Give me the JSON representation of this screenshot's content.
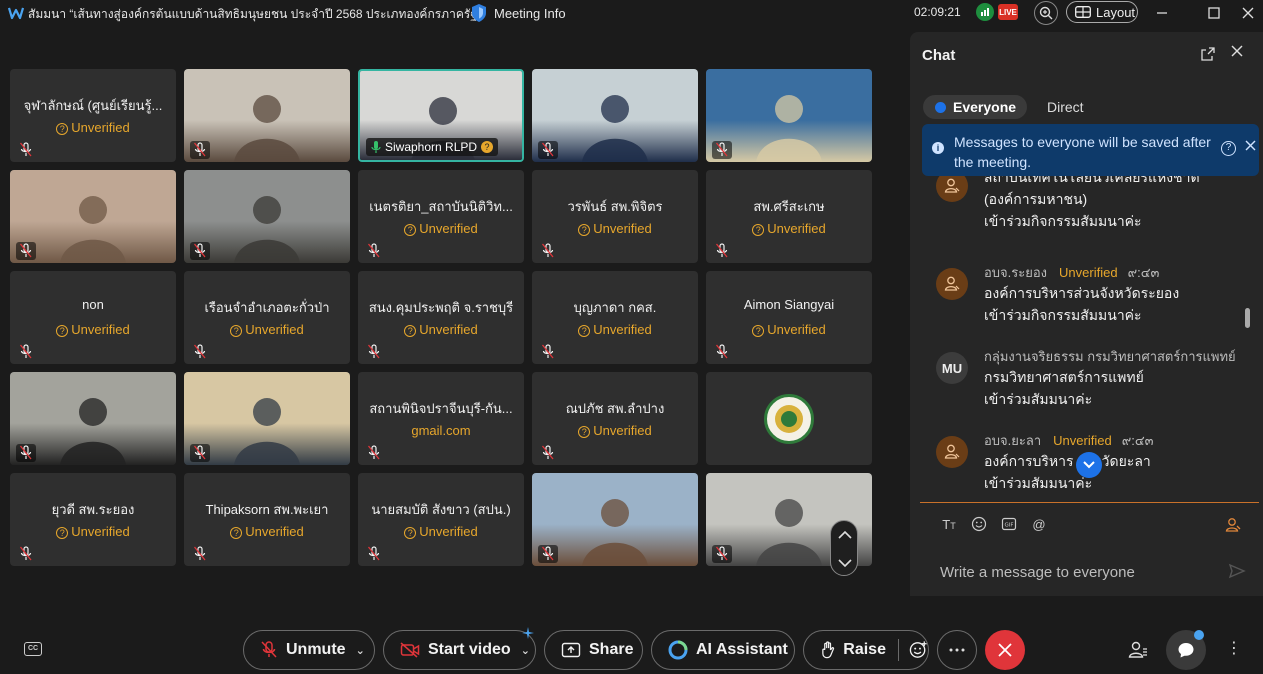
{
  "titlebar": {
    "title": "สัมมนา “เส้นทางสู่องค์กรต้นแบบด้านสิทธิมนุษยชน ประจำปี 2568 ประเภทองค์กรภาครัฐ”",
    "meeting_info": "Meeting Info",
    "clock": "02:09:21",
    "live_badge": "LIVE",
    "layout_label": "Layout"
  },
  "grid": {
    "unverified_label": "Unverified",
    "tiles": [
      {
        "name": "จุฬาลักษณ์ (ศูนย์เรียนรู้...",
        "unverified": true
      },
      {
        "name": "",
        "video": true
      },
      {
        "name": "Siwaphorn RLPD",
        "video": true,
        "active": true
      },
      {
        "name": "",
        "video": true
      },
      {
        "name": "",
        "video": true
      },
      {
        "name": "",
        "video": true
      },
      {
        "name": "",
        "video": true
      },
      {
        "name": "เนตรติยา_สถาบันนิติวิท...",
        "unverified": true
      },
      {
        "name": "วรพันธ์  สพ.พิจิตร",
        "unverified": true
      },
      {
        "name": "สพ.ศรีสะเกษ",
        "unverified": true
      },
      {
        "name": "non",
        "unverified": true
      },
      {
        "name": "เรือนจำอำเภอตะกั่วป่า",
        "unverified": true
      },
      {
        "name": "สนง.คุมประพฤติ จ.ราชบุรี",
        "unverified": true
      },
      {
        "name": "บุญภาดา กคส.",
        "unverified": true
      },
      {
        "name": "Aimon Siangyai",
        "unverified": true
      },
      {
        "name": "",
        "video": true
      },
      {
        "name": "",
        "video": true
      },
      {
        "name": "สถานพินิจปราจีนบุรี-กัน...",
        "sub": "gmail.com"
      },
      {
        "name": "ณปภัช สพ.ลำปาง",
        "unverified": true
      },
      {
        "name": "",
        "logo": true
      },
      {
        "name": "ยุวดี สพ.ระยอง",
        "unverified": true
      },
      {
        "name": "Thipaksorn สพ.พะเยา",
        "unverified": true
      },
      {
        "name": "นายสมบัติ สังขาว (สปน.)",
        "unverified": true
      },
      {
        "name": "",
        "video": true
      },
      {
        "name": "",
        "video": true
      }
    ]
  },
  "chat": {
    "title": "Chat",
    "tab_everyone": "Everyone",
    "tab_direct": "Direct",
    "notice": "Messages to everyone will be saved after the meeting.",
    "messages": [
      {
        "sender": "",
        "unverified": "",
        "time": "",
        "lines": [
          "สถาบันเทคโนโลยีนิวเคลียร์แห่งชาติ",
          "(องค์การมหาชน)",
          "เข้าร่วมกิจกรรมสัมมนาค่ะ"
        ],
        "avatar": "person"
      },
      {
        "sender": "อบจ.ระยอง",
        "unverified": "Unverified",
        "time": "๙:๔๓",
        "lines": [
          "องค์การบริหารส่วนจังหวัดระยอง",
          "เข้าร่วมกิจกรรมสัมมนาค่ะ"
        ],
        "avatar": "person"
      },
      {
        "sender": "กลุ่มงานจริยธรรม กรมวิทยาศาสตร์การแพทย์",
        "unverified": "",
        "time": "",
        "lines": [
          "กรมวิทยาศาสตร์การแพทย์",
          "เข้าร่วมสัมมนาค่ะ"
        ],
        "avatar": "MU"
      },
      {
        "sender": "อบจ.ยะลา",
        "unverified": "Unverified",
        "time": "๙:๔๓",
        "lines": [
          "องค์การบริหาร      จังหวัดยะลา",
          "เข้าร่วมสัมมนาค่ะ"
        ],
        "avatar": "person"
      }
    ],
    "compose_placeholder": "Write a message to everyone"
  },
  "bottombar": {
    "unmute": "Unmute",
    "start_video": "Start video",
    "share": "Share",
    "ai_assistant": "AI Assistant",
    "raise": "Raise"
  }
}
